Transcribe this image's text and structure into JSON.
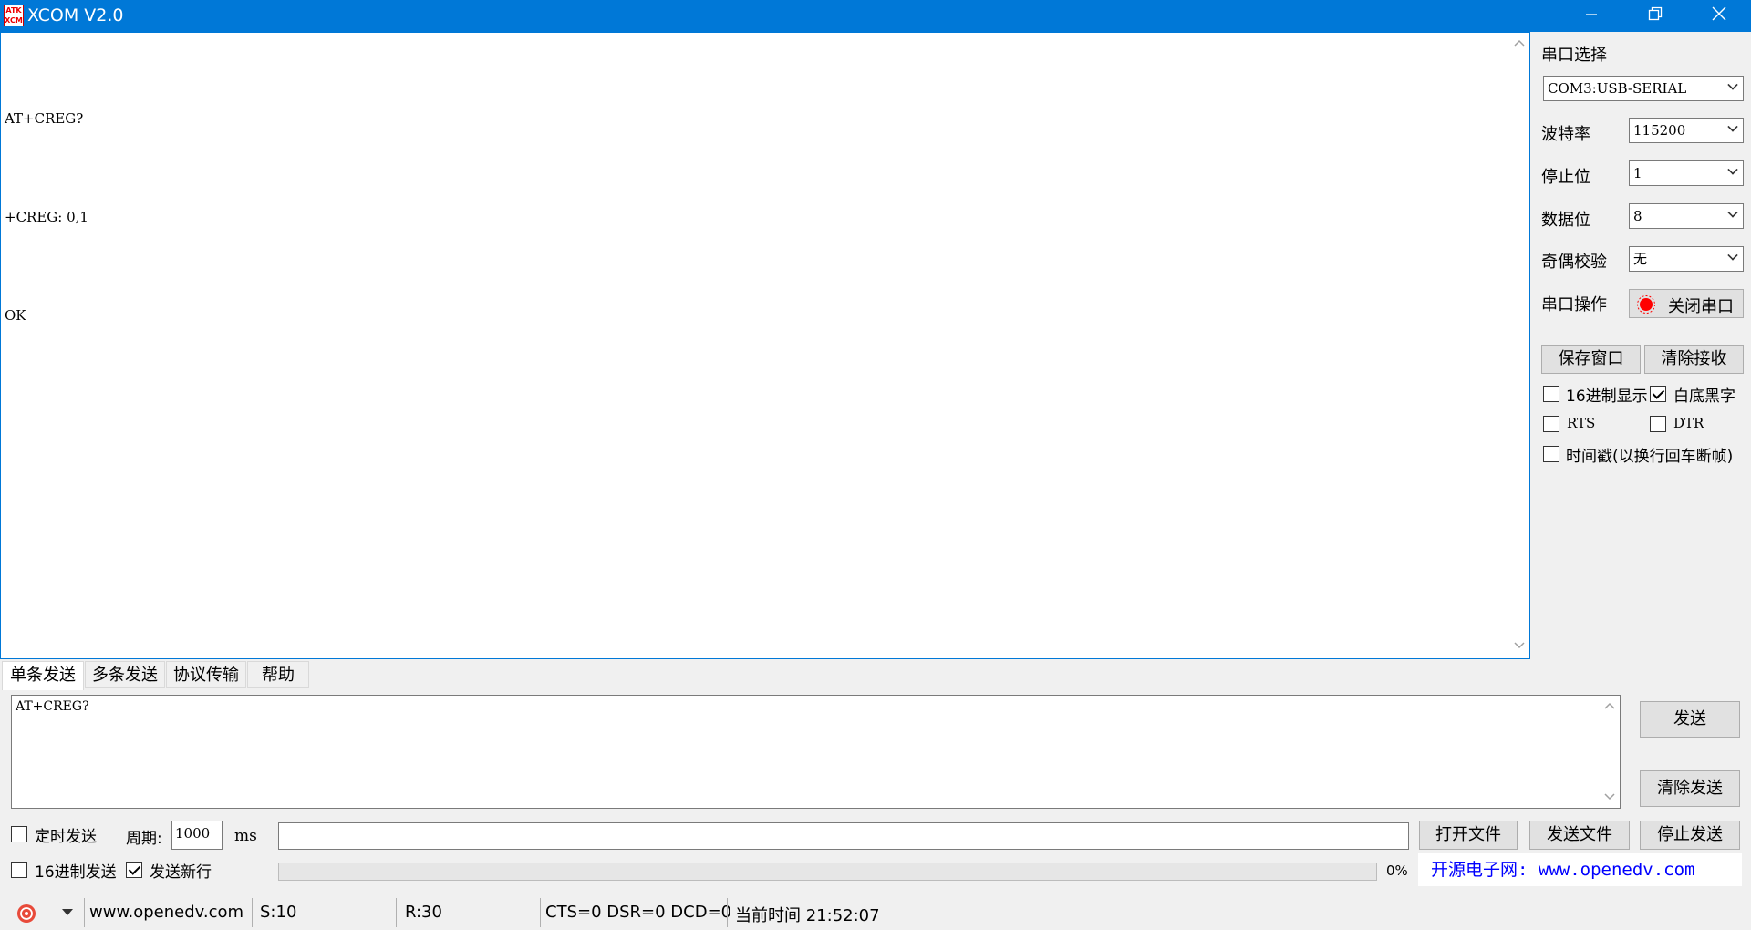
{
  "window": {
    "title": "XCOM V2.0",
    "icon_text_top": "ATK",
    "icon_text_bottom": "XCM"
  },
  "receive": {
    "lines": [
      "AT+CREG?",
      "+CREG: 0,1",
      "OK"
    ]
  },
  "serial": {
    "port_label": "串口选择",
    "port_value": "COM3:USB-SERIAL",
    "baud_label": "波特率",
    "baud_value": "115200",
    "stop_label": "停止位",
    "stop_value": "1",
    "data_label": "数据位",
    "data_value": "8",
    "parity_label": "奇偶校验",
    "parity_value": "无",
    "op_label": "串口操作",
    "close_port_label": "关闭串口"
  },
  "receive_controls": {
    "save_window": "保存窗口",
    "clear_receive": "清除接收",
    "hex_display": {
      "label": "16进制显示",
      "checked": false
    },
    "white_bg": {
      "label": "白底黑字",
      "checked": true
    },
    "rts": {
      "label": "RTS",
      "checked": false
    },
    "dtr": {
      "label": "DTR",
      "checked": false
    },
    "timestamp": {
      "label": "时间戳(以换行回车断帧)",
      "checked": false
    }
  },
  "tabs": [
    {
      "label": "单条发送",
      "active": true
    },
    {
      "label": "多条发送",
      "active": false
    },
    {
      "label": "协议传输",
      "active": false
    },
    {
      "label": "帮助",
      "active": false
    }
  ],
  "send": {
    "text": "AT+CREG?",
    "send_button": "发送",
    "clear_send_button": "清除发送",
    "timed_send": {
      "label": "定时发送",
      "checked": false
    },
    "period_label": "周期:",
    "period_value": "1000",
    "period_unit": "ms",
    "hex_send": {
      "label": "16进制发送",
      "checked": false
    },
    "send_newline": {
      "label": "发送新行",
      "checked": true
    },
    "file_path": "",
    "open_file": "打开文件",
    "send_file": "发送文件",
    "stop_send": "停止发送",
    "progress": 0,
    "progress_text": "0%",
    "banner": "开源电子网: www.openedv.com"
  },
  "status": {
    "website": "www.openedv.com",
    "sent": "S:10",
    "received": "R:30",
    "lines": "CTS=0 DSR=0 DCD=0",
    "time": "当前时间 21:52:07"
  },
  "colors": {
    "titlebar": "#0078d7",
    "close_port_indicator": "#ff0000",
    "banner_text": "#0000ff"
  }
}
